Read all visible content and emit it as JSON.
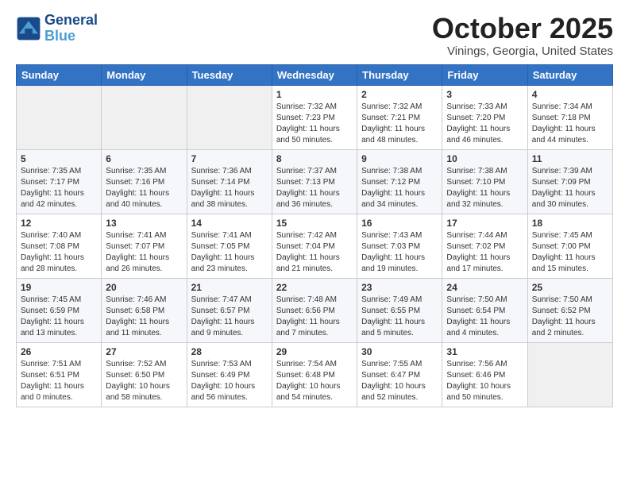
{
  "header": {
    "logo_line1": "General",
    "logo_line2": "Blue",
    "month_title": "October 2025",
    "location": "Vinings, Georgia, United States"
  },
  "weekdays": [
    "Sunday",
    "Monday",
    "Tuesday",
    "Wednesday",
    "Thursday",
    "Friday",
    "Saturday"
  ],
  "weeks": [
    [
      {
        "day": "",
        "info": ""
      },
      {
        "day": "",
        "info": ""
      },
      {
        "day": "",
        "info": ""
      },
      {
        "day": "1",
        "info": "Sunrise: 7:32 AM\nSunset: 7:23 PM\nDaylight: 11 hours\nand 50 minutes."
      },
      {
        "day": "2",
        "info": "Sunrise: 7:32 AM\nSunset: 7:21 PM\nDaylight: 11 hours\nand 48 minutes."
      },
      {
        "day": "3",
        "info": "Sunrise: 7:33 AM\nSunset: 7:20 PM\nDaylight: 11 hours\nand 46 minutes."
      },
      {
        "day": "4",
        "info": "Sunrise: 7:34 AM\nSunset: 7:18 PM\nDaylight: 11 hours\nand 44 minutes."
      }
    ],
    [
      {
        "day": "5",
        "info": "Sunrise: 7:35 AM\nSunset: 7:17 PM\nDaylight: 11 hours\nand 42 minutes."
      },
      {
        "day": "6",
        "info": "Sunrise: 7:35 AM\nSunset: 7:16 PM\nDaylight: 11 hours\nand 40 minutes."
      },
      {
        "day": "7",
        "info": "Sunrise: 7:36 AM\nSunset: 7:14 PM\nDaylight: 11 hours\nand 38 minutes."
      },
      {
        "day": "8",
        "info": "Sunrise: 7:37 AM\nSunset: 7:13 PM\nDaylight: 11 hours\nand 36 minutes."
      },
      {
        "day": "9",
        "info": "Sunrise: 7:38 AM\nSunset: 7:12 PM\nDaylight: 11 hours\nand 34 minutes."
      },
      {
        "day": "10",
        "info": "Sunrise: 7:38 AM\nSunset: 7:10 PM\nDaylight: 11 hours\nand 32 minutes."
      },
      {
        "day": "11",
        "info": "Sunrise: 7:39 AM\nSunset: 7:09 PM\nDaylight: 11 hours\nand 30 minutes."
      }
    ],
    [
      {
        "day": "12",
        "info": "Sunrise: 7:40 AM\nSunset: 7:08 PM\nDaylight: 11 hours\nand 28 minutes."
      },
      {
        "day": "13",
        "info": "Sunrise: 7:41 AM\nSunset: 7:07 PM\nDaylight: 11 hours\nand 26 minutes."
      },
      {
        "day": "14",
        "info": "Sunrise: 7:41 AM\nSunset: 7:05 PM\nDaylight: 11 hours\nand 23 minutes."
      },
      {
        "day": "15",
        "info": "Sunrise: 7:42 AM\nSunset: 7:04 PM\nDaylight: 11 hours\nand 21 minutes."
      },
      {
        "day": "16",
        "info": "Sunrise: 7:43 AM\nSunset: 7:03 PM\nDaylight: 11 hours\nand 19 minutes."
      },
      {
        "day": "17",
        "info": "Sunrise: 7:44 AM\nSunset: 7:02 PM\nDaylight: 11 hours\nand 17 minutes."
      },
      {
        "day": "18",
        "info": "Sunrise: 7:45 AM\nSunset: 7:00 PM\nDaylight: 11 hours\nand 15 minutes."
      }
    ],
    [
      {
        "day": "19",
        "info": "Sunrise: 7:45 AM\nSunset: 6:59 PM\nDaylight: 11 hours\nand 13 minutes."
      },
      {
        "day": "20",
        "info": "Sunrise: 7:46 AM\nSunset: 6:58 PM\nDaylight: 11 hours\nand 11 minutes."
      },
      {
        "day": "21",
        "info": "Sunrise: 7:47 AM\nSunset: 6:57 PM\nDaylight: 11 hours\nand 9 minutes."
      },
      {
        "day": "22",
        "info": "Sunrise: 7:48 AM\nSunset: 6:56 PM\nDaylight: 11 hours\nand 7 minutes."
      },
      {
        "day": "23",
        "info": "Sunrise: 7:49 AM\nSunset: 6:55 PM\nDaylight: 11 hours\nand 5 minutes."
      },
      {
        "day": "24",
        "info": "Sunrise: 7:50 AM\nSunset: 6:54 PM\nDaylight: 11 hours\nand 4 minutes."
      },
      {
        "day": "25",
        "info": "Sunrise: 7:50 AM\nSunset: 6:52 PM\nDaylight: 11 hours\nand 2 minutes."
      }
    ],
    [
      {
        "day": "26",
        "info": "Sunrise: 7:51 AM\nSunset: 6:51 PM\nDaylight: 11 hours\nand 0 minutes."
      },
      {
        "day": "27",
        "info": "Sunrise: 7:52 AM\nSunset: 6:50 PM\nDaylight: 10 hours\nand 58 minutes."
      },
      {
        "day": "28",
        "info": "Sunrise: 7:53 AM\nSunset: 6:49 PM\nDaylight: 10 hours\nand 56 minutes."
      },
      {
        "day": "29",
        "info": "Sunrise: 7:54 AM\nSunset: 6:48 PM\nDaylight: 10 hours\nand 54 minutes."
      },
      {
        "day": "30",
        "info": "Sunrise: 7:55 AM\nSunset: 6:47 PM\nDaylight: 10 hours\nand 52 minutes."
      },
      {
        "day": "31",
        "info": "Sunrise: 7:56 AM\nSunset: 6:46 PM\nDaylight: 10 hours\nand 50 minutes."
      },
      {
        "day": "",
        "info": ""
      }
    ]
  ]
}
